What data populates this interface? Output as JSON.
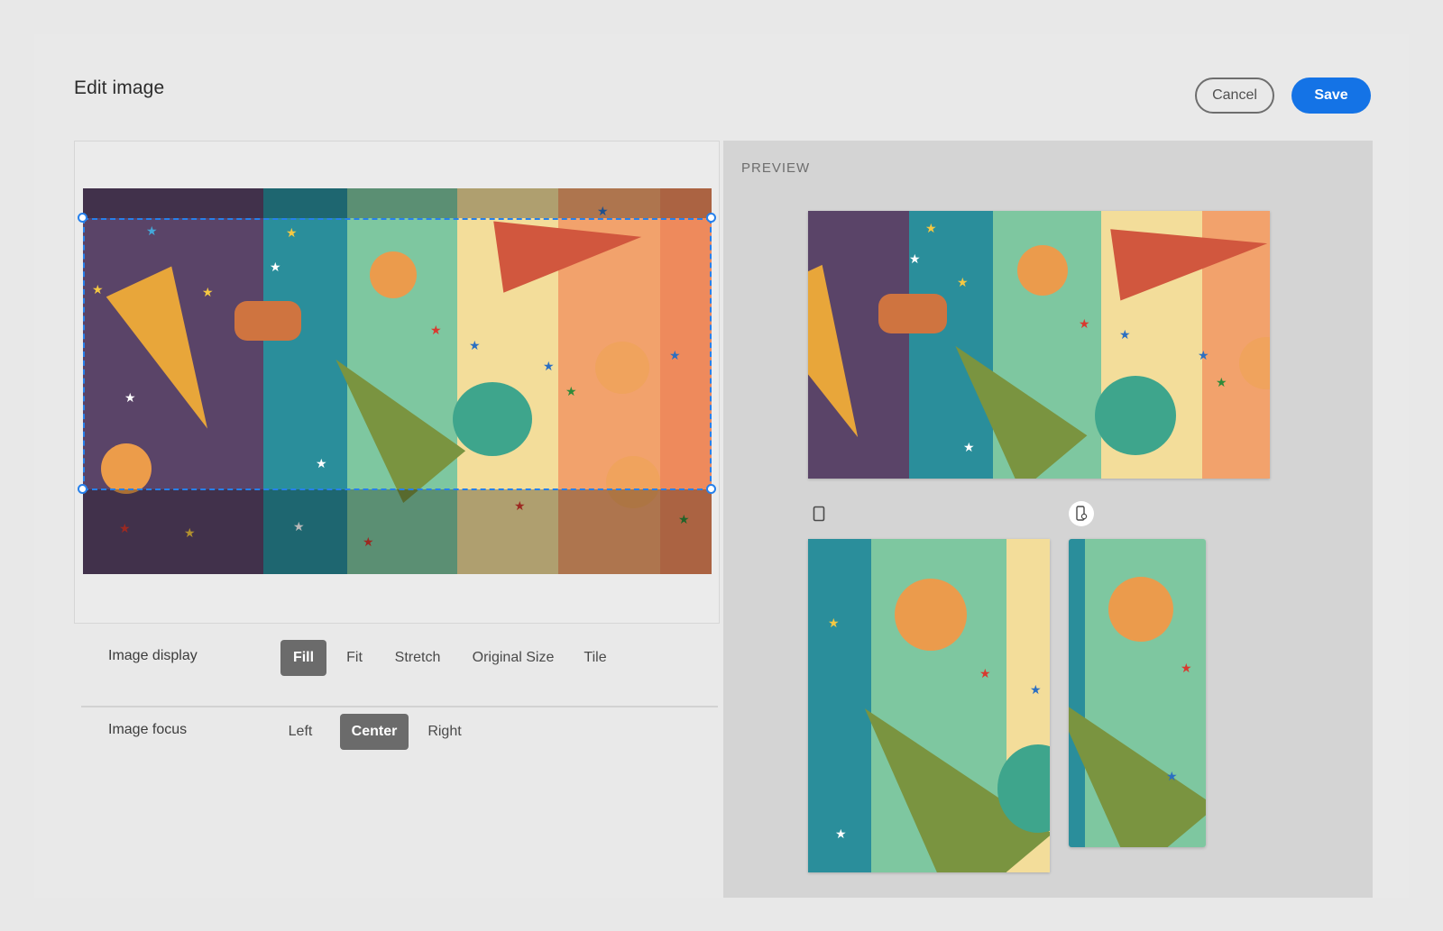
{
  "header": {
    "title": "Edit image",
    "cancel_label": "Cancel",
    "save_label": "Save"
  },
  "preview": {
    "label": "PREVIEW",
    "devices": [
      {
        "icon": "tablet-icon",
        "active": false
      },
      {
        "icon": "mobile-icon",
        "active": true
      }
    ]
  },
  "controls": {
    "image_display": {
      "label": "Image display",
      "options": [
        "Fill",
        "Fit",
        "Stretch",
        "Original Size",
        "Tile"
      ],
      "selected": "Fill"
    },
    "image_focus": {
      "label": "Image focus",
      "options": [
        "Left",
        "Center",
        "Right"
      ],
      "selected": "Center"
    }
  },
  "colors": {
    "accent": "#1473e6",
    "crop_border": "#2680eb",
    "selected_option": "#6b6b6b",
    "stripes": [
      "#5a4468",
      "#2a8e9b",
      "#7ec7a0",
      "#f3dd9a",
      "#f2a26c",
      "#ee8a5c"
    ]
  }
}
